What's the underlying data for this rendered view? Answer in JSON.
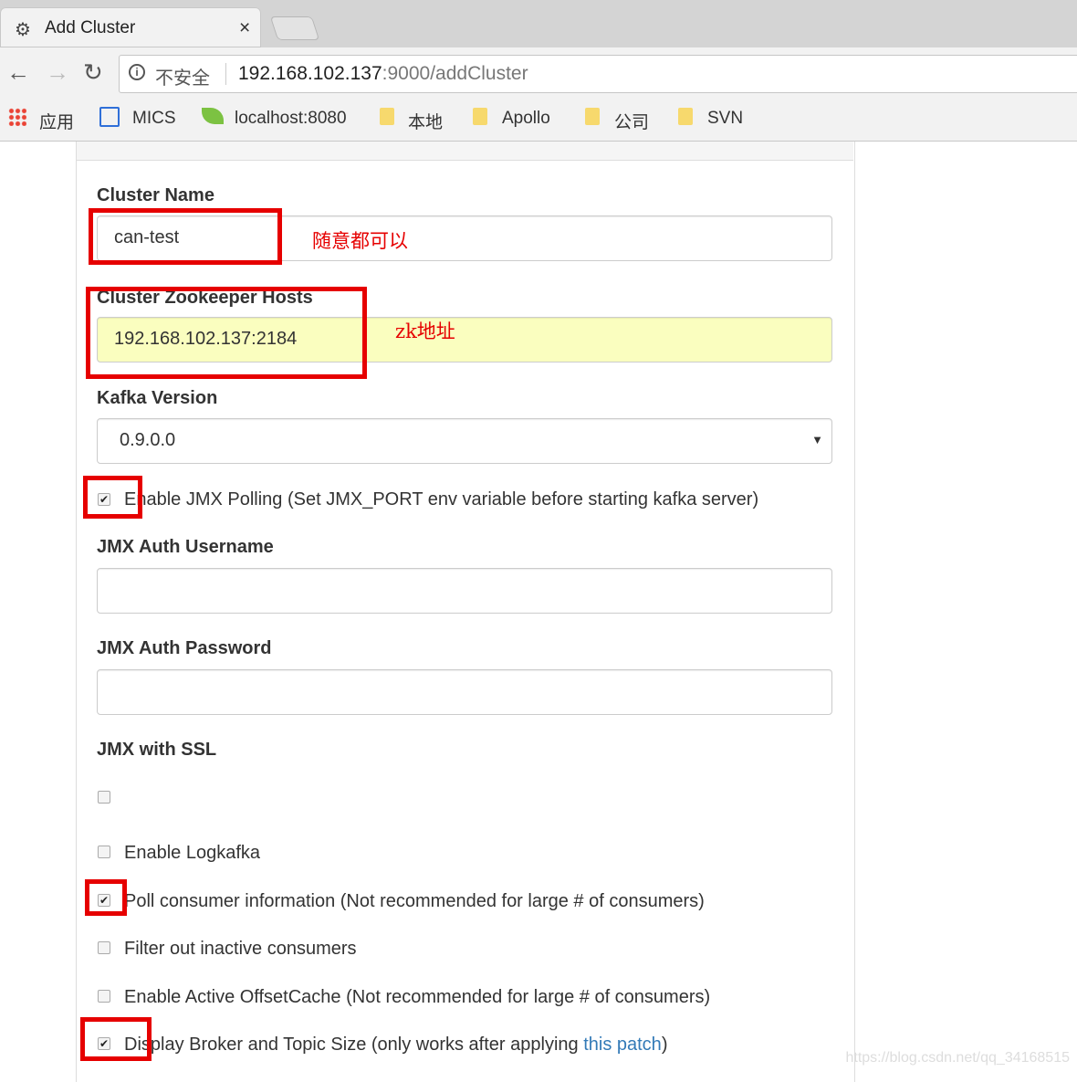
{
  "browser": {
    "tab_title": "Add Cluster",
    "tab_close": "×",
    "security_label": "不安全",
    "url_host": "192.168.102.137",
    "url_rest": ":9000/addCluster",
    "bookmarks": [
      {
        "label": "应用",
        "icon": "apps-grid-icon"
      },
      {
        "label": "MICS",
        "icon": "mics-logo-icon"
      },
      {
        "label": "localhost:8080",
        "icon": "spring-leaf-icon"
      },
      {
        "label": "本地",
        "icon": "folder-icon"
      },
      {
        "label": "Apollo",
        "icon": "folder-icon"
      },
      {
        "label": "公司",
        "icon": "folder-icon"
      },
      {
        "label": "SVN",
        "icon": "folder-icon"
      }
    ]
  },
  "form": {
    "cluster_name_label": "Cluster Name",
    "cluster_name_value": "can-test",
    "zk_hosts_label": "Cluster Zookeeper Hosts",
    "zk_hosts_value": "192.168.102.137:2184",
    "kafka_version_label": "Kafka Version",
    "kafka_version_value": "0.9.0.0",
    "enable_jmx_label": "Enable JMX Polling (Set JMX_PORT env variable before starting kafka server)",
    "enable_jmx_checked": true,
    "jmx_user_label": "JMX Auth Username",
    "jmx_user_value": "",
    "jmx_pass_label": "JMX Auth Password",
    "jmx_pass_value": "",
    "jmx_ssl_label": "JMX with SSL",
    "jmx_ssl_checked": false,
    "logkafka_label": "Enable Logkafka",
    "logkafka_checked": false,
    "poll_consumer_label": "Poll consumer information (Not recommended for large # of consumers)",
    "poll_consumer_checked": true,
    "filter_inactive_label": "Filter out inactive consumers",
    "filter_inactive_checked": false,
    "offset_cache_label": "Enable Active OffsetCache (Not recommended for large # of consumers)",
    "offset_cache_checked": false,
    "display_size_label_pre": "Display Broker and Topic Size (only works after applying ",
    "display_size_link": "this patch",
    "display_size_label_post": ")",
    "display_size_checked": true
  },
  "annotations": {
    "name_note": "随意都可以",
    "zk_note": "zk地址",
    "highlight_color": "#e60000"
  },
  "watermark": "https://blog.csdn.net/qq_34168515"
}
